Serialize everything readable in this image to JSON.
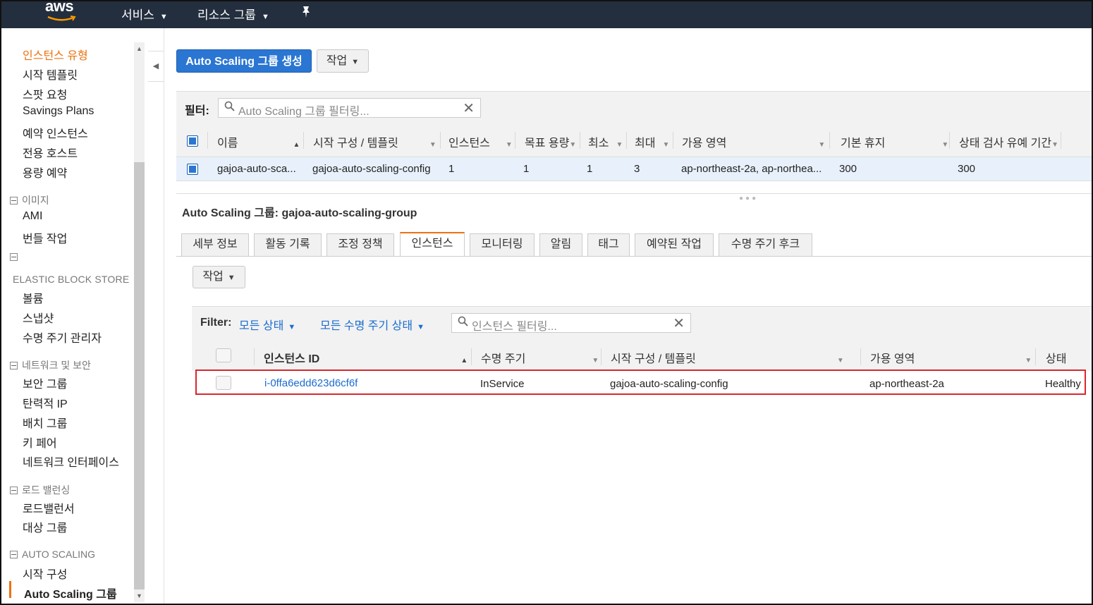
{
  "topbar": {
    "logo": "aws",
    "services": "서비스",
    "resource_groups": "리소스 그룹"
  },
  "sidebar": {
    "items_top": [
      "인스턴스 유형",
      "시작 템플릿",
      "스팟 요청",
      "Savings Plans",
      "예약 인스턴스",
      "전용 호스트",
      "용량 예약"
    ],
    "images_head": "이미지",
    "images": [
      "AMI",
      "번들 작업"
    ],
    "ebs_head": "ELASTIC BLOCK STORE",
    "ebs": [
      "볼륨",
      "스냅샷",
      "수명 주기 관리자"
    ],
    "network_head": "네트워크 및 보안",
    "network": [
      "보안 그룹",
      "탄력적 IP",
      "배치 그룹",
      "키 페어",
      "네트워크 인터페이스"
    ],
    "lb_head": "로드 밸런싱",
    "lb": [
      "로드밸런서",
      "대상 그룹"
    ],
    "as_head": "AUTO SCALING",
    "as_items": [
      "시작 구성",
      "Auto Scaling 그룹"
    ]
  },
  "toolbar": {
    "create_label": "Auto Scaling 그룹 생성",
    "actions_label": "작업"
  },
  "filter": {
    "label": "필터:",
    "placeholder": "Auto Scaling 그룹 필터링..."
  },
  "groups_table": {
    "headers": [
      "이름",
      "시작 구성 / 템플릿",
      "인스턴스",
      "목표 용량",
      "최소",
      "최대",
      "가용 영역",
      "기본 휴지",
      "상태 검사 유예 기간"
    ],
    "row": [
      "gajoa-auto-sca...",
      "gajoa-auto-scaling-config",
      "1",
      "1",
      "1",
      "3",
      "ap-northeast-2a, ap-northea...",
      "300",
      "300"
    ]
  },
  "detail": {
    "title": "Auto Scaling 그룹: gajoa-auto-scaling-group",
    "tabs": [
      "세부 정보",
      "활동 기록",
      "조정 정책",
      "인스턴스",
      "모니터링",
      "알림",
      "태그",
      "예약된 작업",
      "수명 주기 후크"
    ],
    "active_tab": "인스턴스",
    "actions_label": "작업"
  },
  "instance_filter": {
    "label": "Filter:",
    "all_states": "모든 상태",
    "all_lifecycle": "모든 수명 주기 상태",
    "placeholder": "인스턴스 필터링..."
  },
  "instances_table": {
    "headers": [
      "인스턴스 ID",
      "수명 주기",
      "시작 구성 / 템플릿",
      "가용 영역",
      "상태"
    ],
    "row": [
      "i-0ffa6edd623d6cf6f",
      "InService",
      "gajoa-auto-scaling-config",
      "ap-northeast-2a",
      "Healthy"
    ]
  },
  "colors": {
    "topbar": "#232f3e",
    "primary": "#2a76d2",
    "accent": "#ec7211",
    "link": "#1a6ccf",
    "highlight": "#d9262e"
  }
}
